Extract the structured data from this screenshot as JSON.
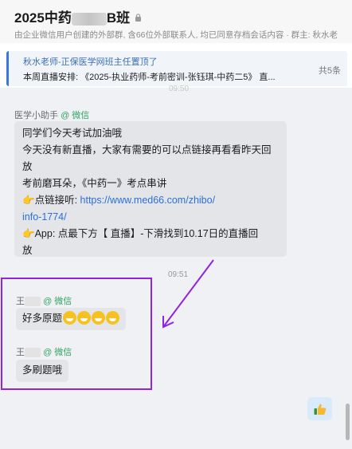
{
  "header": {
    "title_prefix": "2025中药",
    "title_suffix": "B班",
    "subtitle": "由企业微信用户创建的外部群, 含66位外部联系人, 均已同意存档会话内容  · 群主: 秋水老"
  },
  "pinned": {
    "line1": "秋水老师-正保医学网班主任置顶了",
    "line2": "本周直播安排: 《2025-执业药师-考前密训-张钰琪-中药二5》 直...",
    "count": "共5条"
  },
  "time_top": "09:50",
  "messages": [
    {
      "sender": "医学小助手",
      "wechat_tag": "@ 微信",
      "lines": {
        "l1": "同学们今天考试加油哦",
        "l2": "今天没有新直播，大家有需要的可以点链接再看看昨天回",
        "l3": "放",
        "l4": "考前磨耳朵，《中药一》考点串讲",
        "l5_prefix": "点链接听: ",
        "l5_link": "https://www.med66.com/zhibo/",
        "l6_link": "info-1774/",
        "l7": "App: 点最下方【 直播】-下滑找到10.17日的直播回",
        "l8": "放"
      }
    },
    {
      "sender": "王",
      "wechat_tag": "@ 微信",
      "text": "好多原题",
      "emoji_count": 4
    },
    {
      "sender": "王",
      "wechat_tag": "@ 微信",
      "text": "多刷题哦"
    }
  ],
  "time_mid": "09:51",
  "self_message": {
    "icon": "thumbs-up-icon"
  },
  "colors": {
    "highlight": "#8f23e6",
    "link": "#2a6fdb",
    "wechat_green": "#31a565",
    "self_bubble": "#d9ebfb"
  }
}
